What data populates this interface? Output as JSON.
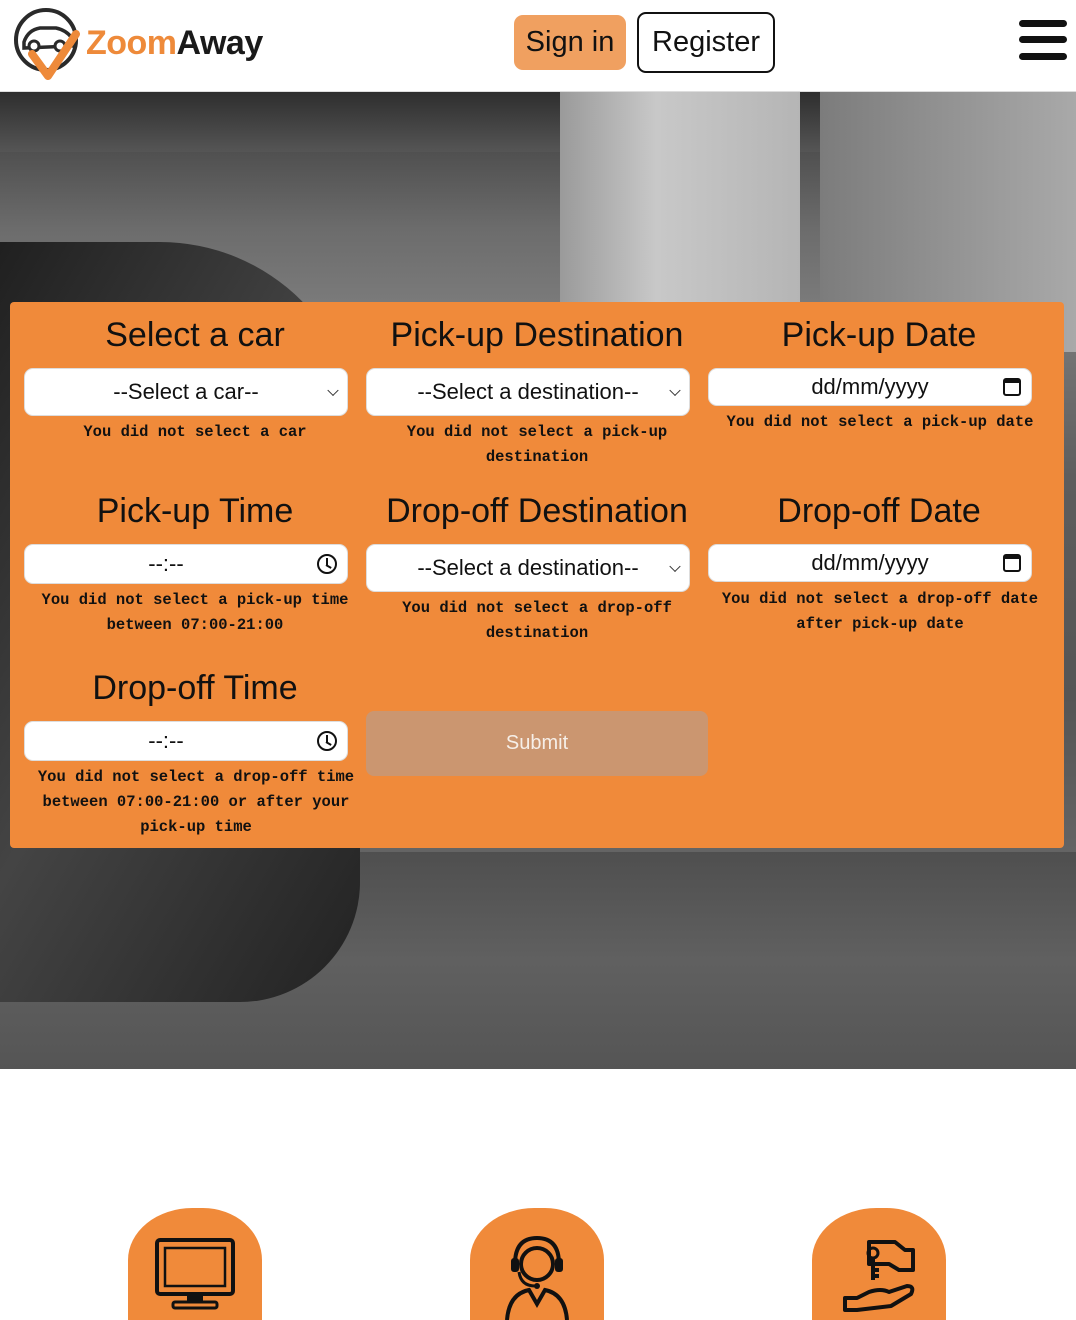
{
  "brand": {
    "part1": "Zoom",
    "part2": "Away"
  },
  "header": {
    "signin_label": "Sign in",
    "register_label": "Register"
  },
  "form": {
    "car": {
      "label": "Select a car",
      "value": "--Select a car--",
      "error": "You did not select a car"
    },
    "pickup_destination": {
      "label": "Pick-up Destination",
      "value": "--Select a destination--",
      "error": "You did not select a pick-up destination"
    },
    "pickup_date": {
      "label": "Pick-up Date",
      "value": "dd/mm/yyyy",
      "error": "You did not select a pick-up date"
    },
    "pickup_time": {
      "label": "Pick-up Time",
      "value": "--:--",
      "error": "You did not select a pick-up time between 07:00-21:00"
    },
    "dropoff_destination": {
      "label": "Drop-off Destination",
      "value": "--Select a destination--",
      "error": "You did not select a drop-off destination"
    },
    "dropoff_date": {
      "label": "Drop-off Date",
      "value": "dd/mm/yyyy",
      "error": "You did not select a drop-off date after pick-up date"
    },
    "dropoff_time": {
      "label": "Drop-off Time",
      "value": "--:--",
      "error": "You did not select a drop-off time between 07:00-21:00 or after your pick-up time"
    },
    "submit_label": "Submit"
  },
  "colors": {
    "accent": "#f08a3a",
    "signin": "#f0a060",
    "submit": "#cb9670"
  },
  "features": [
    {
      "icon": "computer-icon"
    },
    {
      "icon": "support-agent-icon"
    },
    {
      "icon": "key-handover-icon"
    }
  ]
}
